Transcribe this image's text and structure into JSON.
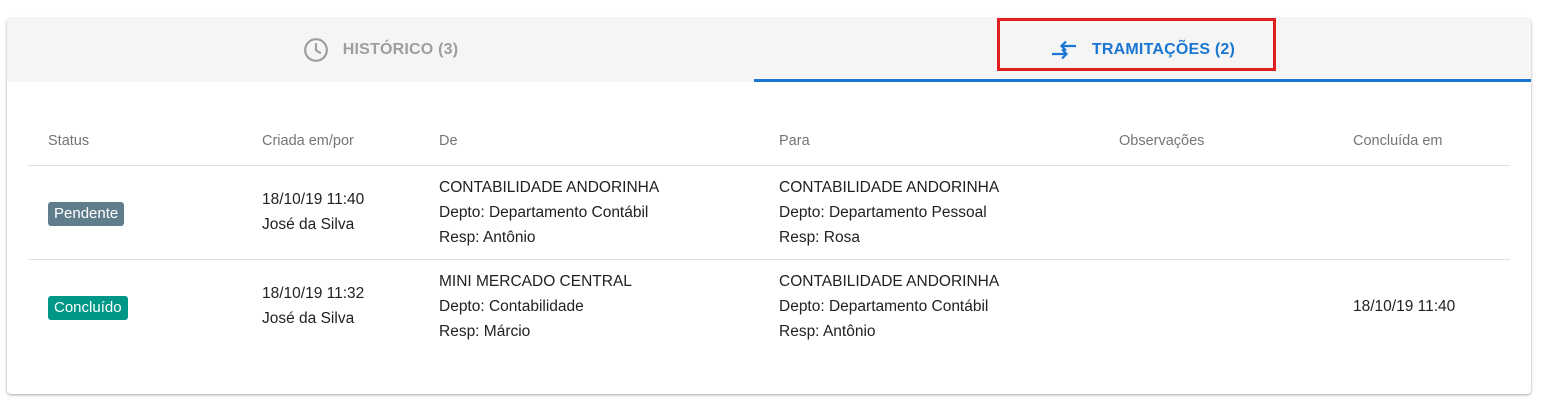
{
  "tabs": {
    "historico": {
      "label": "HISTÓRICO (3)",
      "icon": "clock-icon"
    },
    "tramitacoes": {
      "label": "TRAMITAÇÕES (2)",
      "icon": "swap-arrows-icon"
    }
  },
  "colors": {
    "accent": "#1976d2",
    "highlight": "#e02020",
    "pending": "#607d8b",
    "done": "#009688"
  },
  "table": {
    "headers": {
      "status": "Status",
      "criada": "Criada em/por",
      "de": "De",
      "para": "Para",
      "obs": "Observações",
      "concluida": "Concluída em"
    },
    "rows": [
      {
        "status": "Pendente",
        "criada_data": "18/10/19 11:40",
        "criada_por": "José da Silva",
        "de_empresa": "CONTABILIDADE ANDORINHA",
        "de_depto": "Depto: Departamento Contábil",
        "de_resp": "Resp: Antônio",
        "para_empresa": "CONTABILIDADE ANDORINHA",
        "para_depto": "Depto: Departamento Pessoal",
        "para_resp": "Resp: Rosa",
        "concluida": ""
      },
      {
        "status": "Concluído",
        "criada_data": "18/10/19 11:32",
        "criada_por": "José da Silva",
        "de_empresa": "MINI MERCADO CENTRAL",
        "de_depto": "Depto: Contabilidade",
        "de_resp": "Resp: Márcio",
        "para_empresa": "CONTABILIDADE ANDORINHA",
        "para_depto": "Depto: Departamento Contábil",
        "para_resp": "Resp: Antônio",
        "concluida": "18/10/19 11:40"
      }
    ]
  }
}
